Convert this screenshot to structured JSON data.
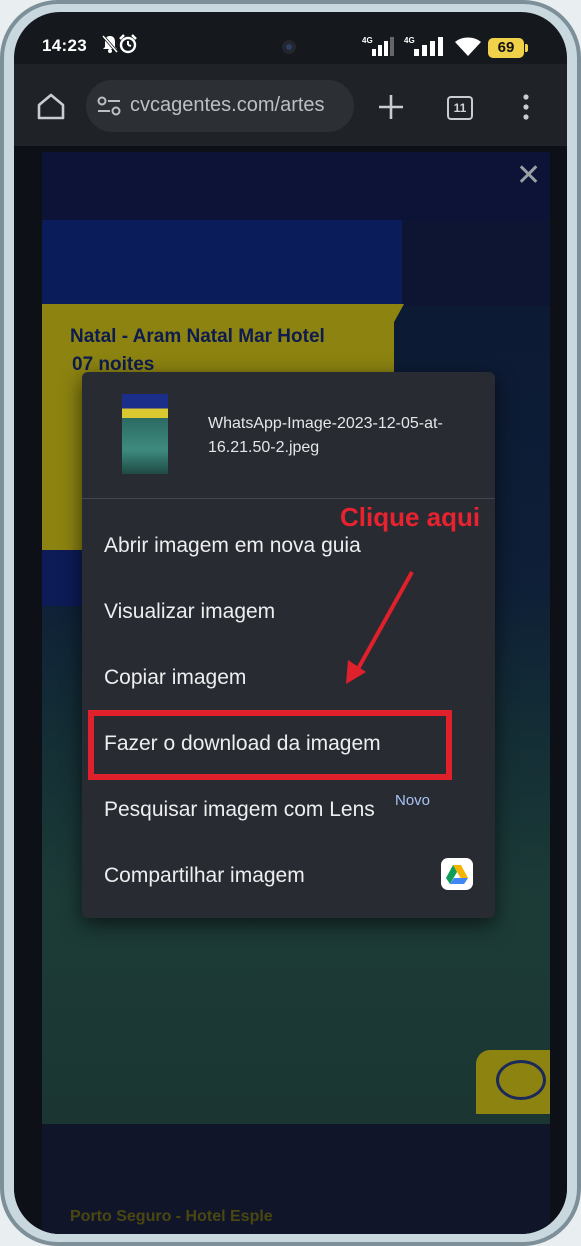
{
  "status_bar": {
    "time": "14:23",
    "network_1": "4G",
    "network_2": "4G",
    "battery": "69"
  },
  "browser": {
    "url": "cvcagentes.com/artes",
    "tab_count": "11"
  },
  "image": {
    "title_line": "Natal - Aram Natal Mar Hotel",
    "subtitle_line": "07 noites",
    "next_banner": "Porto Seguro - Hotel Esple"
  },
  "context_menu": {
    "file_name": "WhatsApp-Image-2023-12-05-at-16.21.50-2.jpeg",
    "items": [
      {
        "label": "Abrir imagem em nova guia"
      },
      {
        "label": "Visualizar imagem"
      },
      {
        "label": "Copiar imagem"
      },
      {
        "label": "Fazer o download da imagem"
      },
      {
        "label": "Pesquisar imagem com Lens"
      },
      {
        "label": "Compartilhar imagem"
      }
    ],
    "new_badge": "Novo"
  },
  "annotation": {
    "label": "Clique aqui",
    "color": "#e0202b"
  },
  "colors": {
    "menu_bg": "#282b31",
    "toolbar_bg": "#1f2226",
    "banner_yellow": "#8c8311"
  }
}
